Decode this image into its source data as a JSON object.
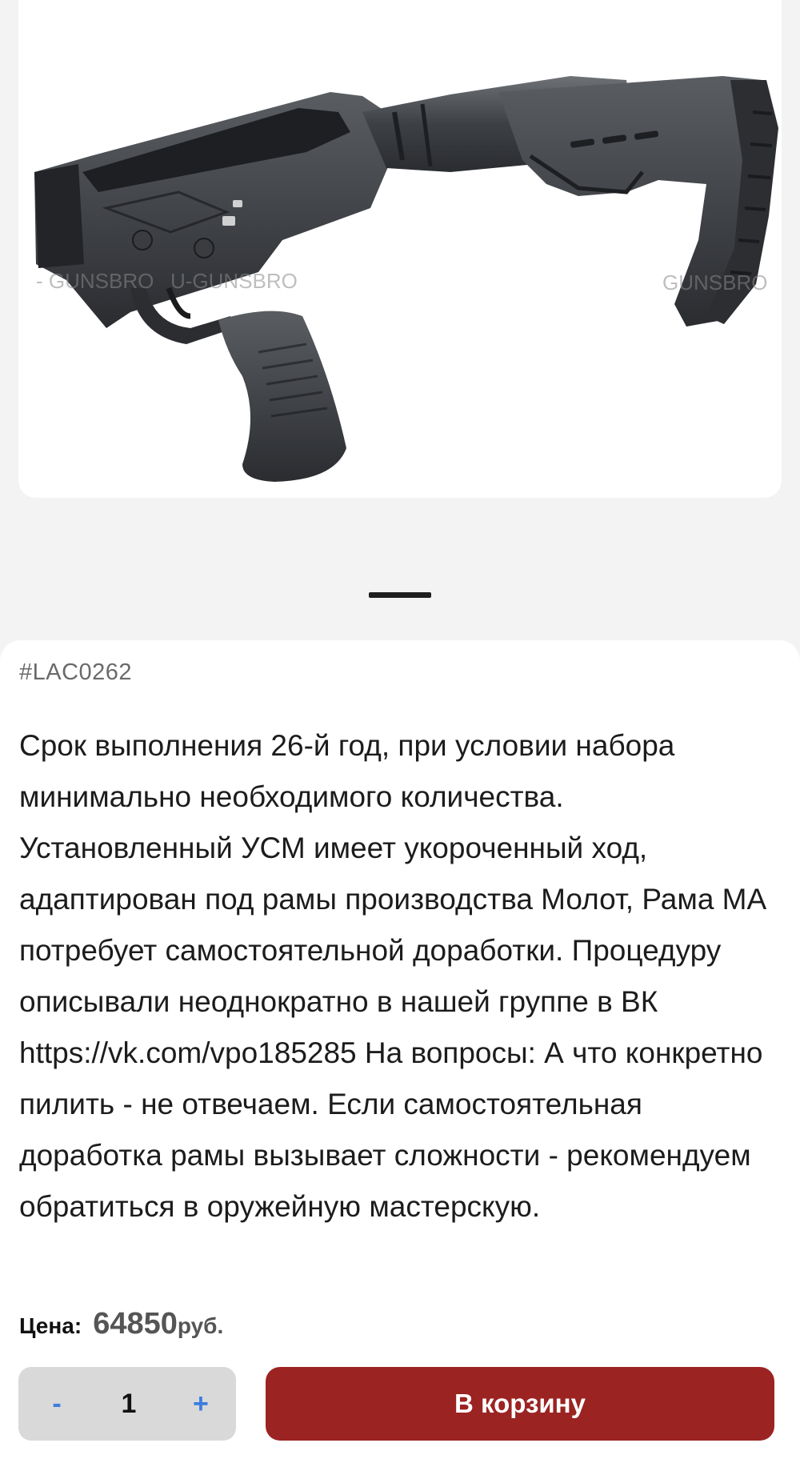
{
  "gallery": {
    "image_alt": "Складной приклад с УСМ",
    "watermark": "GUNSBRO",
    "active_slide": 1
  },
  "product": {
    "sku": "#LAC0262",
    "description": "Срок выполнения 26-й год, при условии набора минимально необходимого количества. Установленный УСМ имеет укороченный ход, адаптирован под рамы производства Молот, Рама МА потребует самостоятельной доработки. Процедуру описывали неоднократно в нашей группе в ВК https://vk.com/vpo185285 На вопросы: А что конкретно пилить - не отвечаем. Если самостоятельная доработка рамы вызывает сложности - рекомендуем обратиться в оружейную мастерскую.",
    "price_label": "Цена:",
    "price_value": "64850",
    "price_currency": "руб."
  },
  "cart": {
    "minus_label": "-",
    "quantity": "1",
    "plus_label": "+",
    "add_button_label": "В корзину"
  },
  "colors": {
    "accent_red": "#9b2322",
    "stepper_blue": "#3c7de0",
    "stepper_bg": "#d9d9d9"
  }
}
